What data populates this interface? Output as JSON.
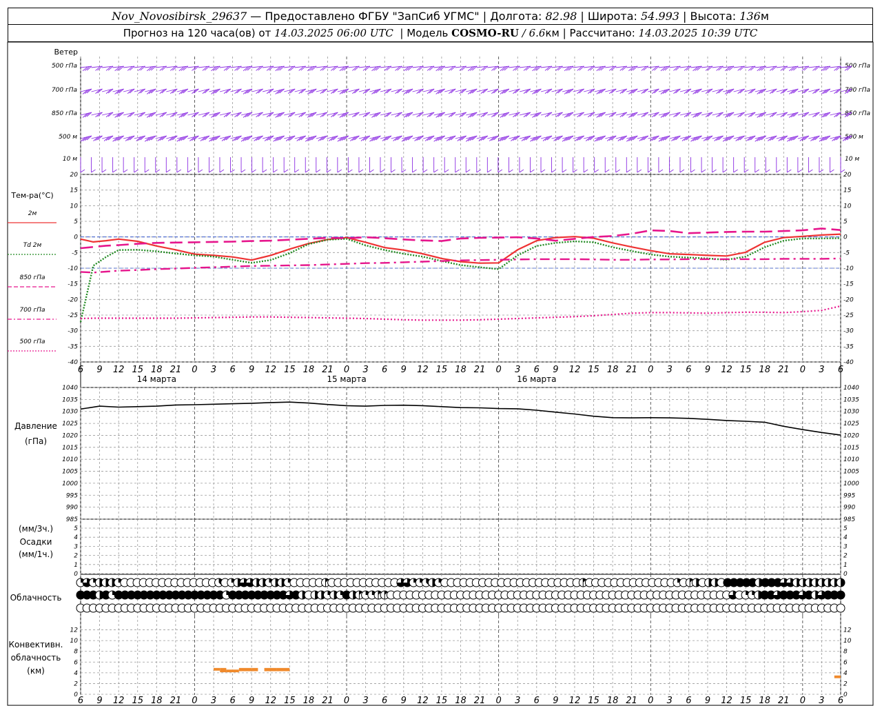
{
  "header": {
    "station": "Nov_Novosibirsk_29637",
    "dash": " — ",
    "provider": "Предоставлено ФГБУ \"ЗапСиб УГМС\"",
    "sep": " | ",
    "lon_label": "Долгота: ",
    "lon": "82.98",
    "lat_label": "Широта: ",
    "lat": "54.993",
    "alt_label": "Высота: ",
    "alt": "136",
    "alt_unit": "м",
    "forecast_label": "Прогноз на 120 часа(ов) от ",
    "forecast_time": "14.03.2025 06:00 UTC",
    "model_label": "Модель ",
    "model": "COSMO-RU",
    "model_res": " / 6.6",
    "model_res_unit": "км",
    "calc_label": "Рассчитано: ",
    "calc_time": "14.03.2025 10:39 UTC"
  },
  "chart_data": [
    {
      "type": "wind-barbs",
      "title": "Ветер",
      "levels": [
        "500 гПа",
        "700 гПа",
        "850 гПа",
        "500 м",
        "10  м"
      ],
      "color": "#8a2be2"
    },
    {
      "type": "line",
      "title": "Тем-ра(°С)",
      "ylim": [
        -40,
        20
      ],
      "yticks": [
        -40,
        -35,
        -30,
        -25,
        -20,
        -15,
        -10,
        -5,
        0,
        5,
        10,
        15,
        20
      ],
      "x_hours": [
        0,
        2,
        4,
        6,
        9,
        12,
        15,
        18,
        21,
        24,
        27,
        30,
        33,
        36,
        39,
        42,
        45,
        48,
        51,
        54,
        57,
        60,
        63,
        66,
        69,
        72,
        75,
        78,
        81,
        84,
        87,
        90,
        93,
        96,
        99,
        102,
        105,
        108,
        111,
        114,
        117,
        120
      ],
      "series": [
        {
          "name": "2м",
          "color": "#ee3333",
          "style": "solid",
          "values": [
            -0.7,
            -1.6,
            -1.2,
            -0.7,
            -1.4,
            -2.9,
            -4.1,
            -5.5,
            -5.9,
            -6.4,
            -7.4,
            -5.9,
            -3.9,
            -2.1,
            -0.8,
            -0.2,
            -1.7,
            -3.4,
            -4.2,
            -5.4,
            -6.9,
            -7.9,
            -8.4,
            -8.3,
            -4.1,
            -1.2,
            -0.2,
            0.1,
            -0.4,
            -1.9,
            -3.2,
            -4.4,
            -5.4,
            -5.6,
            -5.9,
            -6.1,
            -4.9,
            -1.7,
            -0.2,
            0.2,
            0.6,
            0.9
          ]
        },
        {
          "name": "Td  2м",
          "color": "#228b22",
          "style": "dotted",
          "values": [
            -27.2,
            -9.2,
            -6.4,
            -4.2,
            -4.1,
            -4.6,
            -5.3,
            -5.9,
            -6.3,
            -7.3,
            -8.3,
            -7.4,
            -5.2,
            -2.3,
            -0.9,
            -0.6,
            -2.7,
            -4.2,
            -5.4,
            -6.3,
            -7.7,
            -9.0,
            -9.7,
            -10.3,
            -5.9,
            -2.9,
            -1.9,
            -1.4,
            -1.7,
            -3.3,
            -4.5,
            -5.6,
            -6.3,
            -6.6,
            -6.9,
            -7.3,
            -6.3,
            -3.3,
            -1.2,
            -0.5,
            -0.5,
            -0.4
          ]
        },
        {
          "name": "850 гПа",
          "color": "#e6158c",
          "style": "dash",
          "values": [
            -3.6,
            -3.2,
            -2.8,
            -2.6,
            -2.2,
            -1.9,
            -1.8,
            -1.7,
            -1.6,
            -1.5,
            -1.3,
            -1.2,
            -0.9,
            -0.6,
            -0.3,
            -0.4,
            -0.1,
            -0.4,
            -0.8,
            -1.1,
            -1.3,
            -0.5,
            -0.3,
            -0.2,
            -0.1,
            -0.5,
            -1.2,
            -0.6,
            0.0,
            0.3,
            1.0,
            2.1,
            1.9,
            1.2,
            1.4,
            1.6,
            1.7,
            1.7,
            1.9,
            2.1,
            2.7,
            2.2
          ]
        },
        {
          "name": "700 гПа",
          "color": "#e6158c",
          "style": "dashdot",
          "values": [
            -11.2,
            -11.4,
            -11.1,
            -10.8,
            -10.6,
            -10.3,
            -10.1,
            -9.9,
            -9.7,
            -9.5,
            -9.3,
            -9.2,
            -9.1,
            -9.0,
            -8.8,
            -8.6,
            -8.4,
            -8.3,
            -8.1,
            -7.9,
            -7.7,
            -7.5,
            -7.4,
            -7.3,
            -7.2,
            -7.1,
            -7.1,
            -7.1,
            -7.2,
            -7.3,
            -7.3,
            -7.2,
            -7.2,
            -7.1,
            -7.1,
            -7.1,
            -7.1,
            -7.1,
            -7.0,
            -7.0,
            -7.0,
            -6.9
          ]
        },
        {
          "name": "500 гПа",
          "color": "#e6158c",
          "style": "fine",
          "values": [
            -26.1,
            -26.0,
            -26.0,
            -26.0,
            -26.0,
            -26.0,
            -26.0,
            -25.9,
            -25.8,
            -25.7,
            -25.6,
            -25.6,
            -25.7,
            -25.8,
            -25.9,
            -26.0,
            -26.1,
            -26.3,
            -26.5,
            -26.6,
            -26.6,
            -26.6,
            -26.5,
            -26.3,
            -26.1,
            -25.9,
            -25.7,
            -25.5,
            -25.2,
            -24.8,
            -24.4,
            -24.2,
            -24.2,
            -24.3,
            -24.4,
            -24.2,
            -24.1,
            -24.1,
            -24.2,
            -23.9,
            -23.5,
            -22.1
          ]
        }
      ]
    },
    {
      "type": "line",
      "title": "Давление",
      "ylabel": "(гПа)",
      "ylim": [
        985,
        1040
      ],
      "yticks": [
        985,
        990,
        995,
        1000,
        1005,
        1010,
        1015,
        1020,
        1025,
        1030,
        1035,
        1040
      ],
      "x_hours": [
        0,
        3,
        6,
        9,
        12,
        15,
        18,
        21,
        24,
        27,
        30,
        33,
        36,
        39,
        42,
        45,
        48,
        51,
        54,
        57,
        60,
        63,
        66,
        69,
        72,
        75,
        78,
        81,
        84,
        87,
        90,
        93,
        96,
        99,
        102,
        105,
        108,
        111,
        114,
        117,
        120
      ],
      "series": [
        {
          "name": "Давление",
          "color": "#000000",
          "values": [
            1031.0,
            1032.2,
            1031.8,
            1032.0,
            1032.2,
            1032.7,
            1032.8,
            1033.0,
            1033.2,
            1033.4,
            1033.7,
            1033.9,
            1033.5,
            1032.9,
            1032.4,
            1032.2,
            1032.5,
            1032.6,
            1032.4,
            1032.0,
            1031.6,
            1031.5,
            1031.2,
            1031.1,
            1030.5,
            1029.7,
            1028.9,
            1028.0,
            1027.4,
            1027.3,
            1027.4,
            1027.3,
            1027.1,
            1026.7,
            1026.2,
            1025.9,
            1025.5,
            1023.8,
            1022.4,
            1021.2,
            1020.1
          ]
        }
      ]
    },
    {
      "type": "bar",
      "title": "Осадки",
      "ylabel": "(мм/3ч.)",
      "ylabel2": "(мм/1ч.)",
      "ylim": [
        0,
        5
      ],
      "yticks": [
        0,
        1,
        2,
        3,
        4,
        5
      ],
      "values": []
    },
    {
      "type": "cloud-symbols",
      "title": "Облачность",
      "rows": [
        [
          "1/4",
          "3/4",
          "1/4",
          "1/2",
          "1/2",
          "1/2",
          "1/4",
          "0",
          "0",
          "0",
          "0",
          "0",
          "0",
          "0",
          "0",
          "0",
          "0",
          "0",
          "0",
          "0",
          "0",
          "0",
          "3/8",
          "0",
          "1/4",
          "1/2",
          "3/4",
          "3/4",
          "1/2",
          "1/2",
          "1/4",
          "1/2",
          "1/2",
          "1/4",
          "0",
          "0",
          "0",
          "0",
          "0",
          "1/8",
          "0",
          "0",
          "0",
          "0",
          "0",
          "0",
          "0",
          "0",
          "0",
          "0",
          "0",
          "3/4",
          "3/4",
          "1/4",
          "1/4",
          "3/8",
          "1/2",
          "1/4",
          "0",
          "0",
          "0",
          "0",
          "0",
          "0",
          "0",
          "0",
          "0",
          "0",
          "0",
          "0",
          "0",
          "0",
          "0",
          "0",
          "0",
          "0",
          "0",
          "0",
          "0",
          "0",
          "1/8",
          "0",
          "0",
          "0",
          "0",
          "0",
          "0",
          "0",
          "0",
          "0",
          "0",
          "0",
          "0",
          "0",
          "0",
          "1/4",
          "0",
          "1/8",
          "1/2",
          "0",
          "1/2",
          "1/2",
          "0",
          "1",
          "1",
          "1",
          "1",
          "1",
          "1/2",
          "1",
          "1",
          "1",
          "3/4",
          "3/4",
          "1/2",
          "1/2",
          "1/2",
          "1/2",
          "1/2",
          "1/2",
          "1/2",
          "1/2"
        ],
        [
          "1",
          "1",
          "1",
          "1/2",
          "1",
          "1/4",
          "1",
          "1",
          "1",
          "1",
          "1",
          "1",
          "1",
          "1",
          "1",
          "1",
          "1",
          "1",
          "1",
          "1",
          "1",
          "1",
          "1",
          "1/4",
          "1",
          "1",
          "1",
          "1",
          "1",
          "1",
          "1",
          "1",
          "1",
          "3/4",
          "1",
          "1/2",
          "0",
          "1/2",
          "1/2",
          "1/4",
          "1/2",
          "1/4",
          "1",
          "1/2",
          "1/8",
          "1/4",
          "1/4",
          "1/8",
          "1/8",
          "0",
          "0",
          "0",
          "0",
          "0",
          "0",
          "0",
          "0",
          "0",
          "0",
          "0",
          "0",
          "0",
          "0",
          "0",
          "0",
          "0",
          "0",
          "0",
          "0",
          "0",
          "0",
          "0",
          "0",
          "0",
          "0",
          "0",
          "0",
          "0",
          "0",
          "0",
          "0",
          "0",
          "0",
          "0",
          "0",
          "0",
          "0",
          "0",
          "0",
          "0",
          "0",
          "0",
          "0",
          "0",
          "0",
          "0",
          "0",
          "0",
          "0",
          "0",
          "0",
          "0",
          "0",
          "3/4",
          "0",
          "1/4",
          "1/4",
          "1/2",
          "1",
          "1",
          "3/4",
          "1",
          "1",
          "1",
          "3/4",
          "1",
          "1/2",
          "3/4",
          "1",
          "1",
          "1"
        ],
        [
          "0",
          "0",
          "0",
          "0",
          "0",
          "0",
          "0",
          "0",
          "0",
          "0",
          "0",
          "0",
          "0",
          "0",
          "0",
          "0",
          "0",
          "0",
          "0",
          "0",
          "0",
          "0",
          "0",
          "0",
          "0",
          "0",
          "0",
          "0",
          "0",
          "0",
          "0",
          "0",
          "0",
          "0",
          "0",
          "0",
          "0",
          "0",
          "0",
          "0",
          "0",
          "0",
          "0",
          "0",
          "0",
          "0",
          "0",
          "0",
          "0",
          "0",
          "0",
          "0",
          "0",
          "0",
          "0",
          "0",
          "0",
          "0",
          "0",
          "0",
          "0",
          "0",
          "0",
          "0",
          "0",
          "0",
          "0",
          "0",
          "0",
          "0",
          "0",
          "0",
          "0",
          "0",
          "0",
          "0",
          "0",
          "0",
          "0",
          "0",
          "0",
          "0",
          "0",
          "0",
          "0",
          "0",
          "0",
          "0",
          "0",
          "0",
          "0",
          "0",
          "0",
          "0",
          "0",
          "0",
          "0",
          "0",
          "0",
          "0",
          "0",
          "0",
          "0",
          "0",
          "0",
          "0",
          "0",
          "0",
          "0",
          "0",
          "0",
          "0",
          "0",
          "0",
          "0",
          "0",
          "0",
          "0",
          "0",
          "0",
          "0"
        ]
      ]
    },
    {
      "type": "bar",
      "title": "Конвективн.",
      "title2": "облачность",
      "ylabel": "(км)",
      "ylim": [
        0,
        14
      ],
      "yticks": [
        0,
        2,
        4,
        6,
        8,
        10,
        12
      ],
      "color": "#f08a2c",
      "segments": [
        {
          "x0": 21.0,
          "x1": 22.0,
          "base": 4.4,
          "top": 4.9
        },
        {
          "x0": 22.0,
          "x1": 23.0,
          "base": 4.1,
          "top": 4.9
        },
        {
          "x0": 23.0,
          "x1": 25.0,
          "base": 4.1,
          "top": 4.6
        },
        {
          "x0": 25.0,
          "x1": 27.0,
          "base": 4.3,
          "top": 4.9
        },
        {
          "x0": 27.0,
          "x1": 28.0,
          "base": 4.3,
          "top": 4.9
        },
        {
          "x0": 29.0,
          "x1": 31.0,
          "base": 4.3,
          "top": 4.9
        },
        {
          "x0": 31.0,
          "x1": 33.0,
          "base": 4.3,
          "top": 4.9
        },
        {
          "x0": 119.0,
          "x1": 120.0,
          "base": 3.0,
          "top": 3.5
        }
      ]
    }
  ],
  "time_axis": {
    "hour_labels": [
      "6",
      "9",
      "12",
      "15",
      "18",
      "21",
      "0",
      "3",
      "6",
      "9",
      "12",
      "15",
      "18",
      "21",
      "0",
      "3",
      "6",
      "9",
      "12",
      "15",
      "18",
      "21",
      "0",
      "3",
      "6",
      "9",
      "12"
    ],
    "day_labels": [
      "14 марта",
      "15 марта",
      "16 марта"
    ]
  }
}
